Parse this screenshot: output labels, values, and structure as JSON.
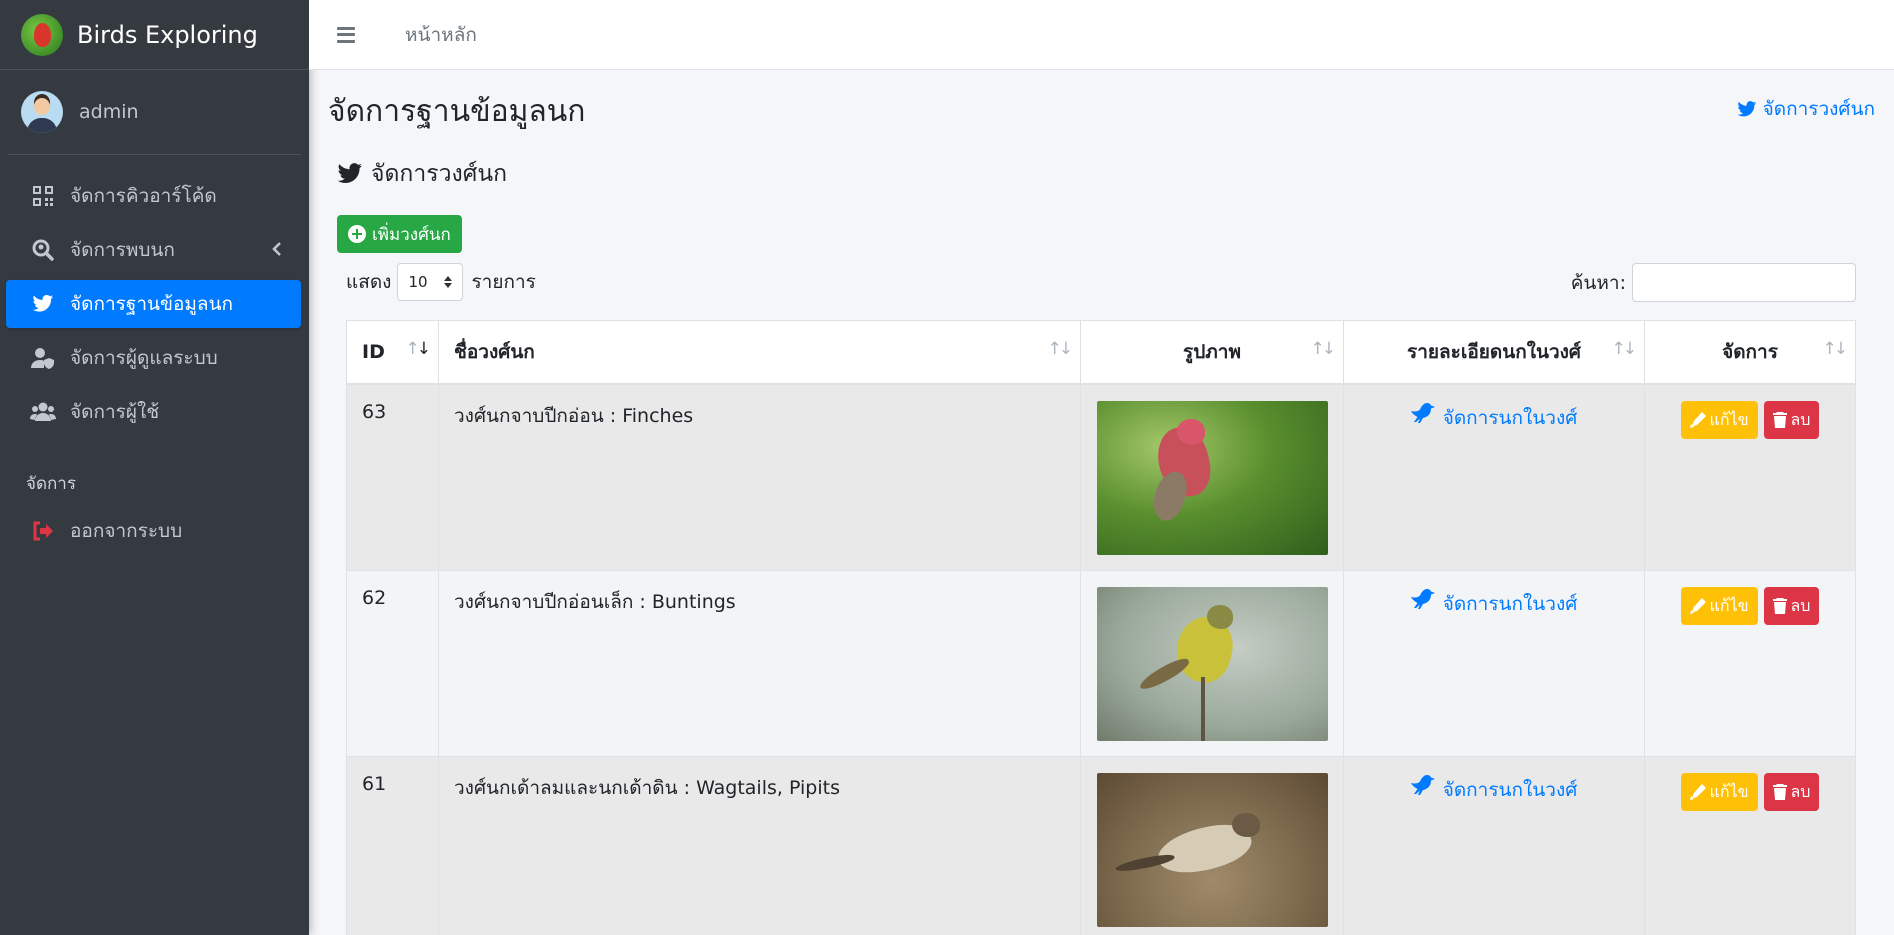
{
  "brand": {
    "name": "Birds Exploring",
    "logo_icon": "parrot-logo-icon"
  },
  "user": {
    "name": "admin"
  },
  "sidebar": {
    "items": [
      {
        "label": "จัดการคิวอาร์โค้ด",
        "icon": "qrcode-icon"
      },
      {
        "label": "จัดการพบนก",
        "icon": "search-location-icon"
      },
      {
        "label": "จัดการฐานข้อมูลนก",
        "icon": "twitter-bird-icon"
      },
      {
        "label": "จัดการผู้ดูแลระบบ",
        "icon": "user-shield-icon"
      },
      {
        "label": "จัดการผู้ใช้",
        "icon": "users-icon"
      }
    ],
    "header": "จัดการ",
    "logout": "ออกจากระบบ"
  },
  "topbar": {
    "home": "หน้าหลัก"
  },
  "page": {
    "title": "จัดการฐานข้อมูลนก",
    "top_right_link": "จัดการวงศ์นก",
    "section_title": "จัดการวงศ์นก",
    "add_button": "เพิ่มวงศ์นก",
    "show_label": "แสดง",
    "show_value": "10",
    "entries_label": "รายการ",
    "search_label": "ค้นหา:"
  },
  "table": {
    "headers": [
      "ID",
      "ชื่อวงศ์นก",
      "รูปภาพ",
      "รายละเอียดนกในวงศ์",
      "จัดการ"
    ],
    "rows": [
      {
        "id": "63",
        "name": "วงศ์นกจาบปีกอ่อน : Finches",
        "detail": "จัดการนกในวงศ์",
        "edit": "แก้ไข",
        "delete": "ลบ"
      },
      {
        "id": "62",
        "name": "วงศ์นกจาบปีกอ่อนเล็ก : Buntings",
        "detail": "จัดการนกในวงศ์",
        "edit": "แก้ไข",
        "delete": "ลบ"
      },
      {
        "id": "61",
        "name": "วงศ์นกเด้าลมและนกเด้าดิน : Wagtails, Pipits",
        "detail": "จัดการนกในวงศ์",
        "edit": "แก้ไข",
        "delete": "ลบ"
      }
    ]
  },
  "colors": {
    "primary": "#007bff",
    "success": "#28a745",
    "warning": "#ffc107",
    "danger": "#dc3545",
    "sidebar": "#343a40"
  }
}
